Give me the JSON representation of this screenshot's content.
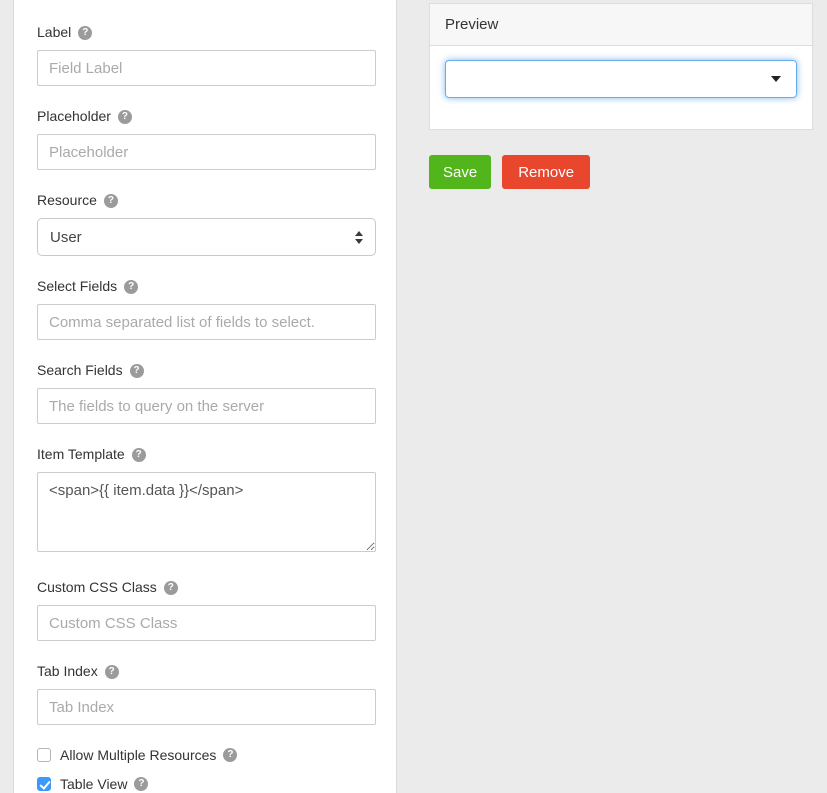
{
  "colors": {
    "page_bg": "#ebebeb",
    "panel_bg": "#ffffff",
    "panel_border": "#dadada",
    "input_border": "#cccccc",
    "placeholder_text": "#aaaaaa",
    "label_text": "#333333",
    "header_bg": "#f7f7f7",
    "save_green": "#52b51c",
    "remove_red": "#e8462d",
    "checkbox_blue": "#3b99fc",
    "focus_blue": "#66afe9",
    "help_icon_gray": "#9b9b9b"
  },
  "form": {
    "fields": [
      {
        "label": "Label",
        "placeholder": "Field Label",
        "value": ""
      },
      {
        "label": "Placeholder",
        "placeholder": "Placeholder",
        "value": ""
      },
      {
        "label": "Resource",
        "value": "User"
      },
      {
        "label": "Select Fields",
        "placeholder": "Comma separated list of fields to select.",
        "value": ""
      },
      {
        "label": "Search Fields",
        "placeholder": "The fields to query on the server",
        "value": ""
      },
      {
        "label": "Item Template",
        "value": "<span>{{ item.data }}</span>"
      },
      {
        "label": "Custom CSS Class",
        "placeholder": "Custom CSS Class",
        "value": ""
      },
      {
        "label": "Tab Index",
        "placeholder": "Tab Index",
        "value": ""
      }
    ],
    "checkboxes": [
      {
        "label": "Allow Multiple Resources",
        "checked": false
      },
      {
        "label": "Table View",
        "checked": true
      }
    ]
  },
  "preview": {
    "title": "Preview",
    "select_value": ""
  },
  "actions": {
    "save": "Save",
    "remove": "Remove"
  },
  "icons": {
    "help": "question-circle",
    "select_stepper": "up-down-arrows",
    "dropdown_caret": "caret-down",
    "checkmark": "check"
  }
}
